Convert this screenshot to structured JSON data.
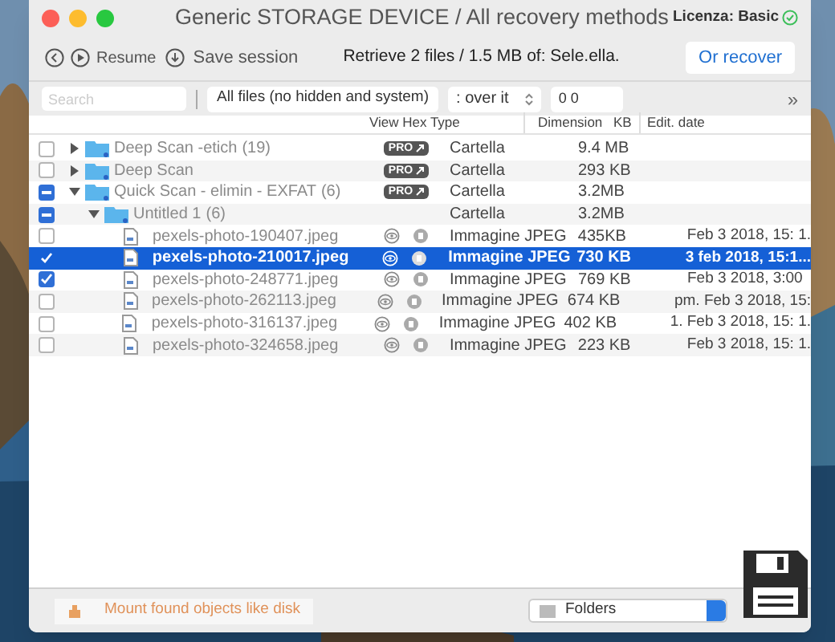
{
  "window": {
    "title": "Generic STORAGE DEVICE / All recovery methods",
    "license": "Licenza: Basic"
  },
  "toolbar": {
    "resume": "Resume",
    "save_session": "Save session",
    "retrieve": "Retrieve 2 files / 1.5 MB of: Sele.ella.",
    "recover": "Or recover"
  },
  "filter_bar": {
    "search": {
      "placeholder": "Search"
    },
    "filter": "All files (no hidden and system)",
    "over": ": over it",
    "size": "0 0",
    "more": "»"
  },
  "table": {
    "columns": [
      "View Hex Type",
      "Dimension",
      "KB",
      "Edit. date"
    ],
    "rows": [
      {
        "kind": "folder",
        "name": "Deep Scan -etich",
        "count": "(19)",
        "pro": "PRO",
        "type": "Cartella",
        "size": "9.4 MB",
        "checked": false,
        "selected": false,
        "expanded": false
      },
      {
        "kind": "folder",
        "name": "Deep Scan",
        "pro": "PRO",
        "type": "Cartella",
        "size": "293 KB",
        "checked": false,
        "selected": false,
        "expanded": false
      },
      {
        "kind": "folder",
        "name": "Quick Scan - elimin - EXFAT",
        "count": "(6)",
        "pro": "PRO",
        "type": "Cartella",
        "size": "3.2MB",
        "checked": true,
        "mixed": true,
        "selected": false,
        "expanded": true,
        "children": [
          {
            "kind": "folder",
            "name": "Untitled 1",
            "count": "(6)",
            "type": "Cartella",
            "size": "3.2MB",
            "checked": true,
            "mixed": true,
            "selected": false,
            "expanded": true,
            "children": [
              {
                "kind": "file",
                "name": "pexels-photo-190407.jpeg",
                "type": "Immagine JPEG",
                "size": "435KB",
                "date": "Feb 3 2018, 15: 1.",
                "checked": false,
                "selected": false
              },
              {
                "kind": "file",
                "name": "pexels-photo-210017.jpeg",
                "type": "Immagine JPEG",
                "size": "730 KB",
                "date": "3 feb 2018, 15:1...",
                "checked": true,
                "selected": true
              },
              {
                "kind": "file",
                "name": "pexels-photo-248771.jpeg",
                "type": "Immagine JPEG",
                "size": "769 KB",
                "date": "Feb 3 2018, 3:00",
                "checked": true,
                "selected": false
              },
              {
                "kind": "file",
                "name": "pexels-photo-262113.jpeg",
                "type": "Immagine JPEG",
                "size": "674 KB",
                "date": "pm. Feb 3 2018, 15:",
                "checked": false,
                "selected": false
              },
              {
                "kind": "file",
                "name": "pexels-photo-316137.jpeg",
                "type": "Immagine JPEG",
                "size": "402 KB",
                "date": "1. Feb 3 2018, 15: 1.",
                "checked": false,
                "selected": false
              },
              {
                "kind": "file",
                "name": "pexels-photo-324658.jpeg",
                "type": "Immagine JPEG",
                "size": "223 KB",
                "date": "Feb 3 2018, 15: 1.",
                "checked": false,
                "selected": false
              }
            ]
          }
        ]
      }
    ]
  },
  "bottom_bar": {
    "mount": "Mount found objects like disk",
    "view": "Folders"
  }
}
